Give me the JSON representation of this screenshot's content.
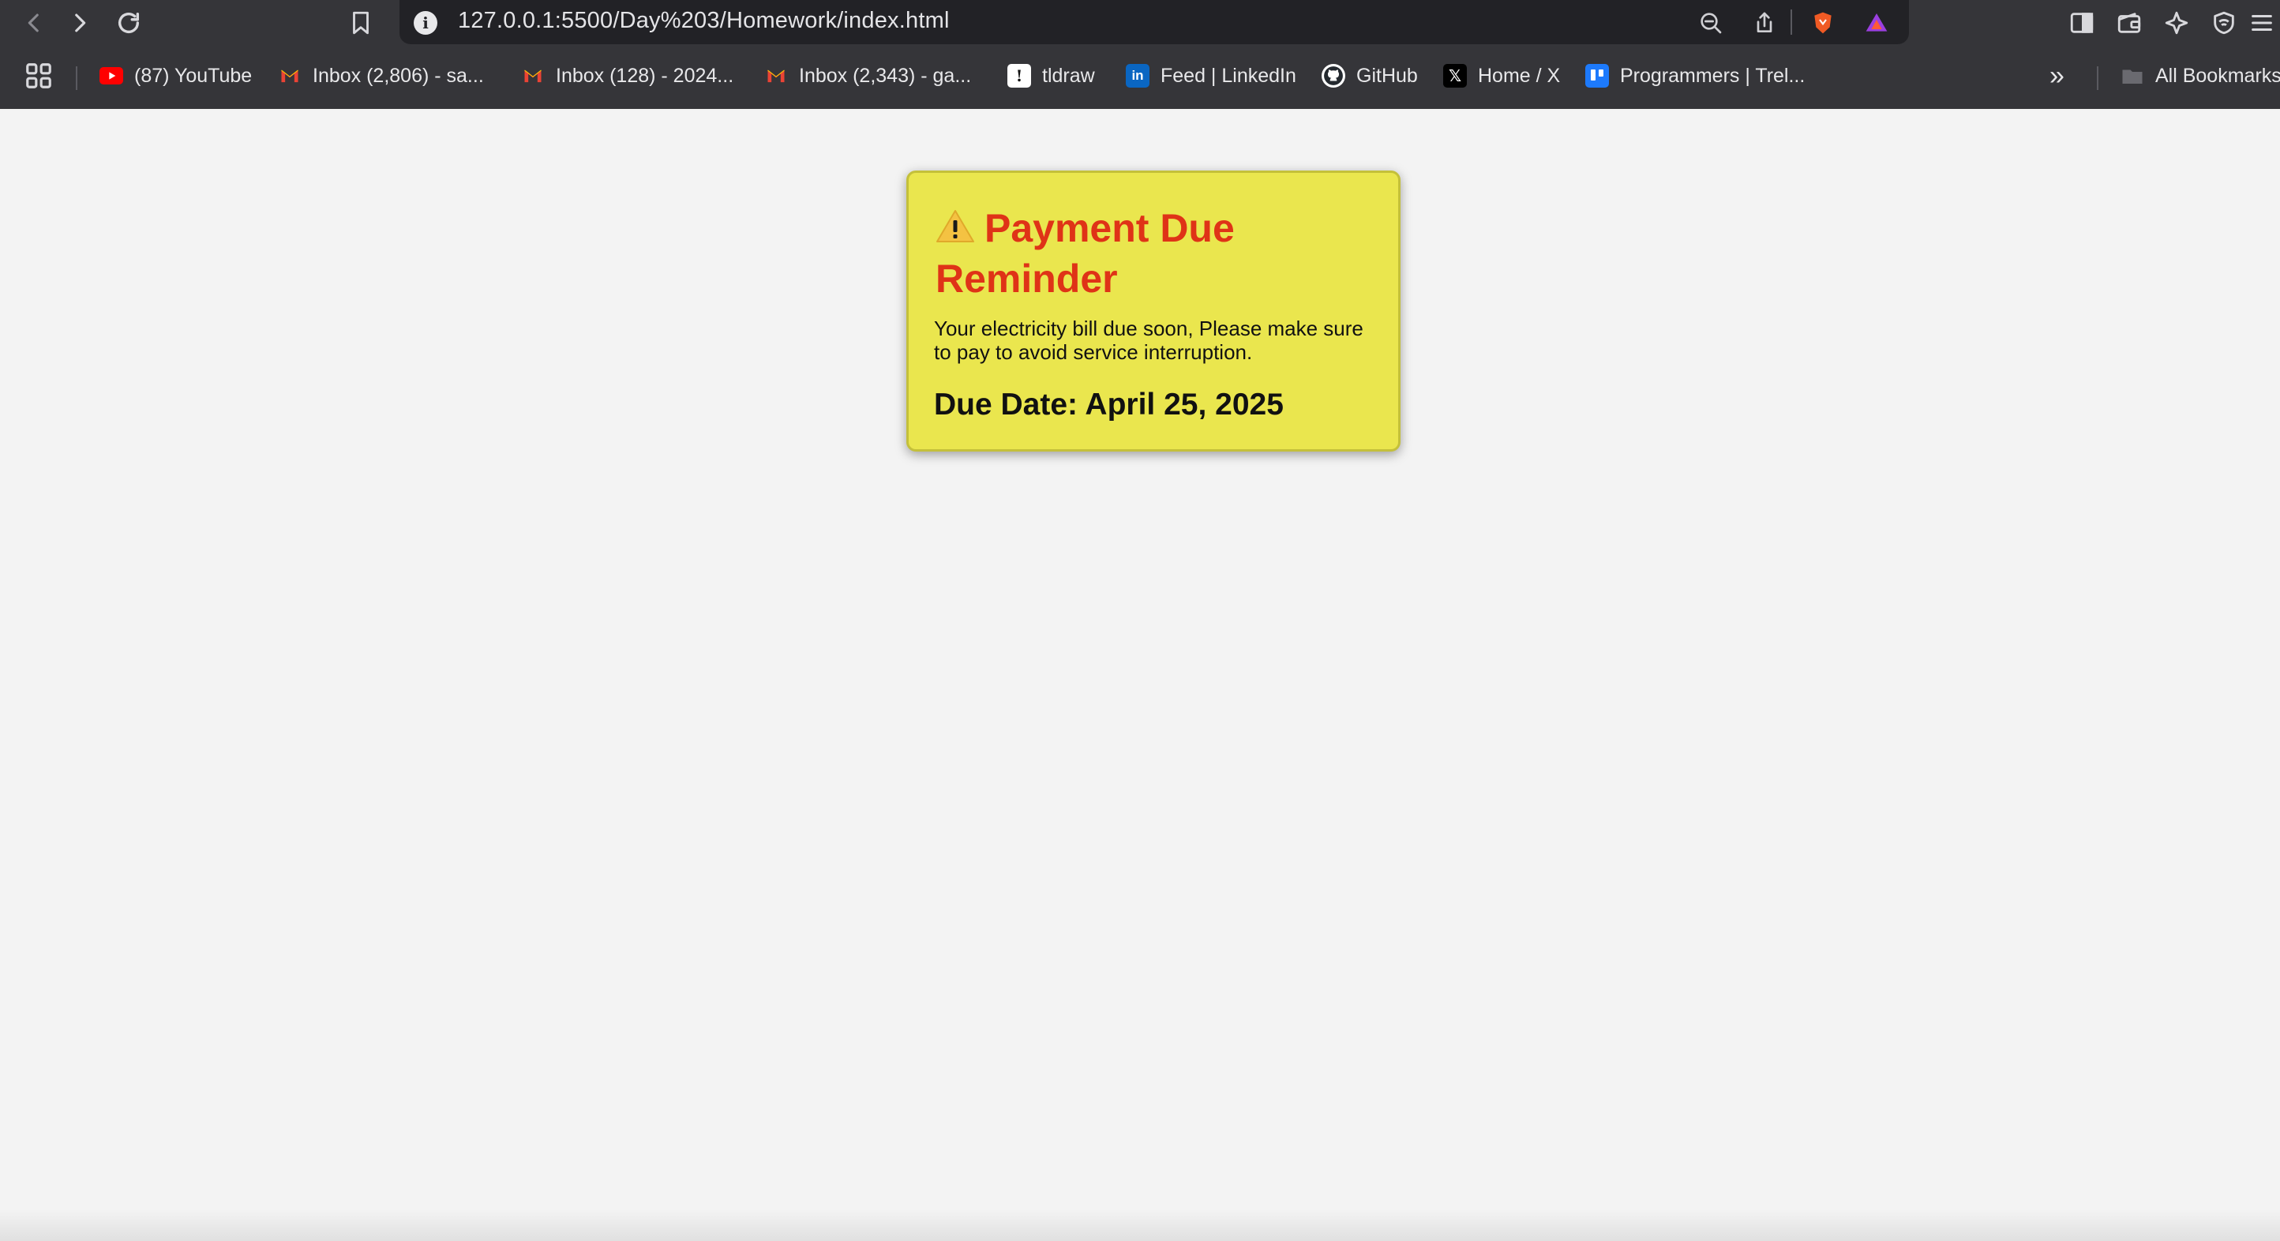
{
  "browser": {
    "url": "127.0.0.1:5500/Day%203/Homework/index.html",
    "icons": [
      "back-icon",
      "forward-icon",
      "reload-icon",
      "bookmark-icon",
      "site-info-icon",
      "zoom-out-icon",
      "share-icon",
      "brave-shields-icon",
      "brave-rewards-icon",
      "sidebar-icon",
      "wallet-icon",
      "leo-ai-icon",
      "vpn-icon",
      "menu-icon"
    ]
  },
  "bookmarks": {
    "items": [
      {
        "label": "(87) YouTube",
        "icon": "youtube-icon"
      },
      {
        "label": "Inbox (2,806) - sa...",
        "icon": "gmail-icon"
      },
      {
        "label": "Inbox (128) - 2024...",
        "icon": "gmail-icon"
      },
      {
        "label": "Inbox (2,343) - ga...",
        "icon": "gmail-icon"
      },
      {
        "label": "tldraw",
        "icon": "tldraw-icon"
      },
      {
        "label": "Feed | LinkedIn",
        "icon": "linkedin-icon"
      },
      {
        "label": "GitHub",
        "icon": "github-icon"
      },
      {
        "label": "Home / X",
        "icon": "x-icon"
      },
      {
        "label": "Programmers | Trel...",
        "icon": "trello-icon"
      }
    ],
    "overflow_label": "»",
    "all_bookmarks_label": "All Bookmarks"
  },
  "card": {
    "heading": "Payment Due Reminder",
    "message": "Your electricity bill due soon, Please make sure to pay to avoid service interruption.",
    "due_date": "Due Date: April 25, 2025",
    "colors": {
      "background": "#eae64e",
      "heading": "#df3317",
      "text": "#111111"
    }
  }
}
